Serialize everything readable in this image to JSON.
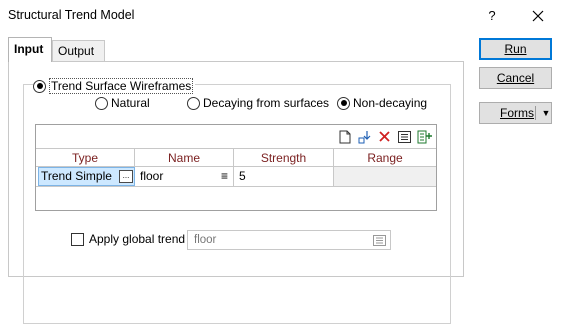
{
  "window": {
    "title": "Structural Trend Model",
    "help_label": "?"
  },
  "tabs": [
    {
      "label": "Input",
      "active": true
    },
    {
      "label": "Output",
      "active": false
    }
  ],
  "group": {
    "label": "Trend Surface Wireframes",
    "selected": true,
    "options": [
      {
        "label": "Natural",
        "selected": false
      },
      {
        "label": "Decaying from surfaces",
        "selected": false
      },
      {
        "label": "Non-decaying",
        "selected": true
      }
    ]
  },
  "grid": {
    "toolbar_icons": [
      "new-row-icon",
      "insert-row-icon",
      "delete-row-icon",
      "list-view-icon",
      "append-row-icon"
    ],
    "columns": [
      "Type",
      "Name",
      "Strength",
      "Range"
    ],
    "rows": [
      {
        "type": "Trend Simple",
        "name": "floor",
        "strength": "5",
        "range": ""
      }
    ],
    "ellipsis": "...",
    "list_glyph": "≡"
  },
  "apply_global": {
    "label": "Apply global trend",
    "checked": false,
    "value": "floor"
  },
  "buttons": {
    "run": "Run",
    "cancel": "Cancel",
    "forms": "Forms",
    "forms_dropdown": "▼"
  },
  "colors": {
    "header_text": "#7a1f1f",
    "selected_cell": "#cde8ff",
    "accent": "#0078d7"
  }
}
